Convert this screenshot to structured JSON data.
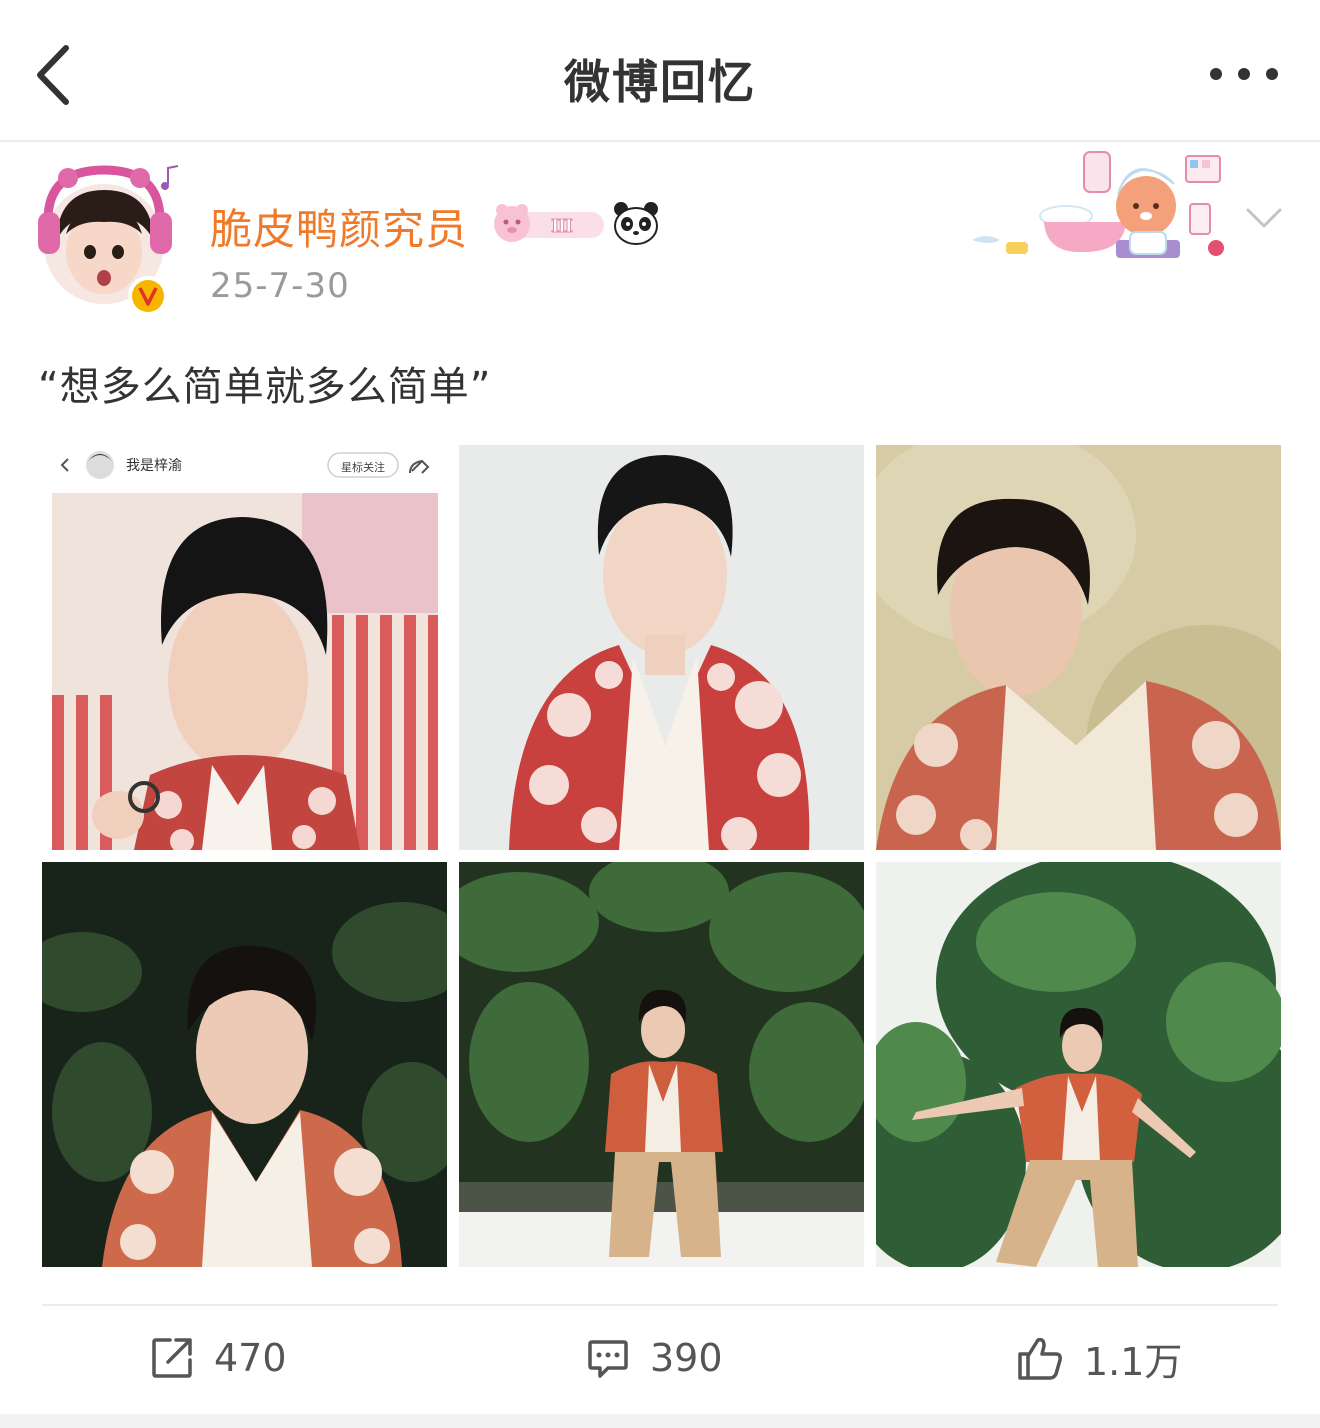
{
  "header": {
    "title": "微博回忆"
  },
  "post": {
    "author_name": "脆皮鸭颜究员",
    "fan_badge_level": "Ⅲ",
    "time": "25-7-30",
    "text": "“想多么简单就多么简单”",
    "photos": [
      {
        "inner_header": {
          "username": "我是梓渝",
          "follow_label": "星标关注"
        }
      },
      {},
      {},
      {},
      {},
      {}
    ]
  },
  "actions": {
    "repost_count": "470",
    "comment_count": "390",
    "like_count": "1.1万"
  },
  "colors": {
    "username": "#f07a2a",
    "verified_badge": "#f7b500"
  },
  "icons": [
    "back-icon",
    "more-icon",
    "verified-icon",
    "panda-icon",
    "chevron-down-icon",
    "repost-icon",
    "comment-icon",
    "like-icon"
  ]
}
